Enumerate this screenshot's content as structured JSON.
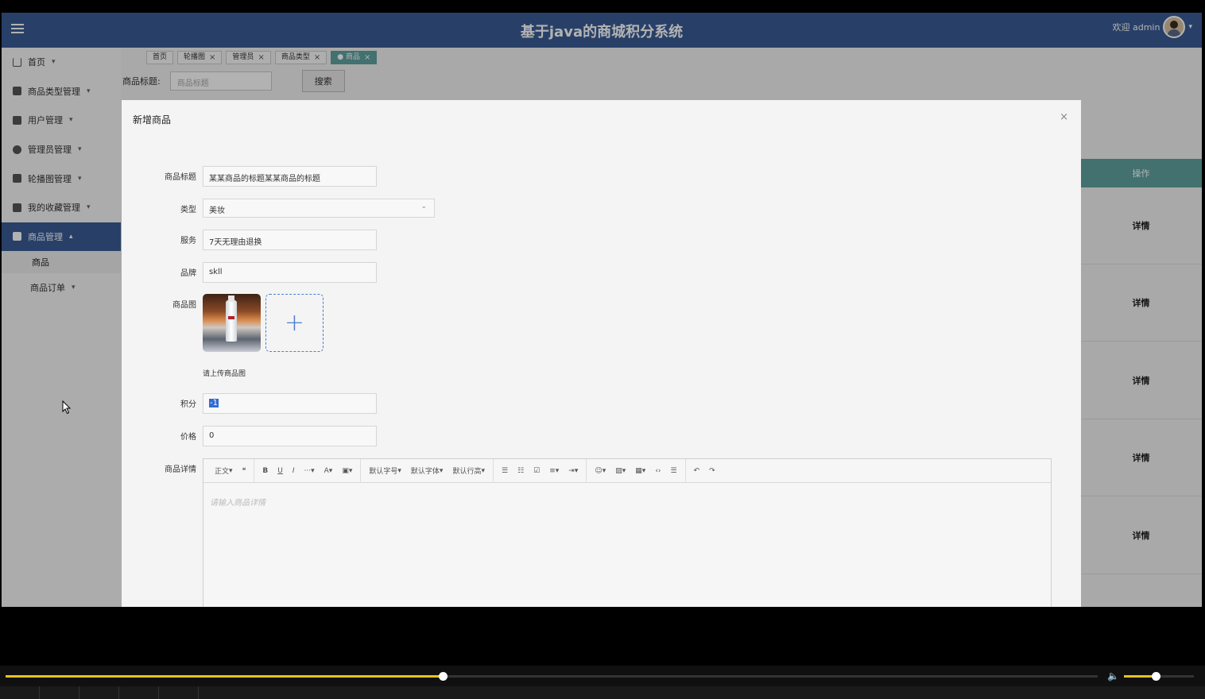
{
  "header": {
    "title": "基于java的商城积分系统",
    "welcome": "欢迎 admin"
  },
  "sidebar": {
    "items": [
      {
        "label": "首页"
      },
      {
        "label": "商品类型管理"
      },
      {
        "label": "用户管理"
      },
      {
        "label": "管理员管理"
      },
      {
        "label": "轮播图管理"
      },
      {
        "label": "我的收藏管理"
      },
      {
        "label": "商品管理"
      }
    ],
    "sub_item": "商品",
    "last_item": "商品订单"
  },
  "tabs": [
    {
      "label": "首页"
    },
    {
      "label": "轮播图"
    },
    {
      "label": "管理员"
    },
    {
      "label": "商品类型"
    },
    {
      "label": "● 商品"
    }
  ],
  "search": {
    "label": "商品标题:",
    "placeholder": "商品标题",
    "button": "搜索"
  },
  "table": {
    "op_header": "操作",
    "detail": "详情"
  },
  "dialog": {
    "title": "新增商品",
    "close": "×",
    "fields": {
      "title_label": "商品标题",
      "title_value": "某某商品的标题某某商品的标题",
      "type_label": "类型",
      "type_value": "美妆",
      "service_label": "服务",
      "service_value": "7天无理由退换",
      "brand_label": "品牌",
      "brand_value": "skll",
      "image_label": "商品图",
      "upload_hint": "请上传商品图",
      "score_label": "积分",
      "score_value": "-1",
      "price_label": "价格",
      "price_value": "0",
      "detail_label": "商品详情",
      "detail_placeholder": "请输入商品详情"
    },
    "toolbar": {
      "paragraph": "正文",
      "font_size": "默认字号",
      "font_family": "默认字体",
      "line_height": "默认行高"
    }
  },
  "player": {
    "progress": 0.4,
    "volume": 0.45
  }
}
